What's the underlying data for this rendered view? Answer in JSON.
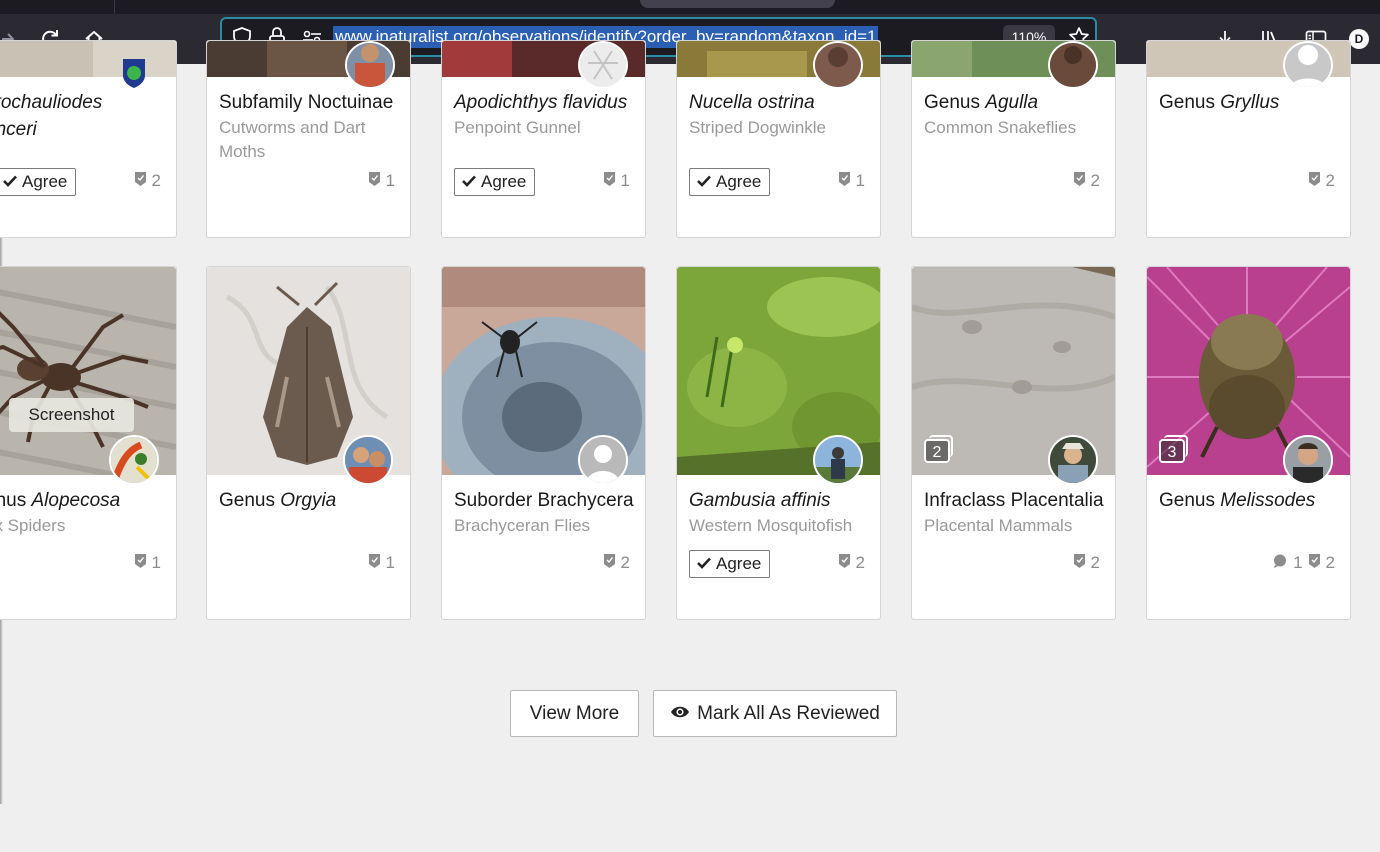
{
  "browser": {
    "url": "www.inaturalist.org/observations/identify?order_by=random&taxon_id=1",
    "zoom": "110%",
    "profile_initial": "D"
  },
  "row1": [
    {
      "title_prefix": "",
      "title_italic": "otochauliodes",
      "title2_italic": "enceri",
      "subtitle": "",
      "agree": "Agree",
      "count": "2"
    },
    {
      "title_prefix": "Subfamily Noctuinae",
      "title_italic": "",
      "subtitle": "Cutworms and Dart Moths",
      "agree": "",
      "count": "1"
    },
    {
      "title_prefix": "",
      "title_italic": "Apodichthys flavidus",
      "subtitle": "Penpoint Gunnel",
      "agree": "Agree",
      "count": "1"
    },
    {
      "title_prefix": "",
      "title_italic": "Nucella ostrina",
      "subtitle": "Striped Dogwinkle",
      "agree": "Agree",
      "count": "1"
    },
    {
      "title_prefix": "Genus ",
      "title_italic": "Agulla",
      "subtitle": "Common Snakeflies",
      "agree": "",
      "count": "2"
    },
    {
      "title_prefix": "Genus ",
      "title_italic": "Gryllus",
      "subtitle": "",
      "agree": "",
      "count": "2"
    }
  ],
  "row2": [
    {
      "title_prefix": "enus ",
      "title_italic": "Alopecosa",
      "subtitle": "ox Spiders",
      "agree": "",
      "count": "1",
      "tooltip": "Screenshot"
    },
    {
      "title_prefix": "Genus ",
      "title_italic": "Orgyia",
      "subtitle": "",
      "agree": "",
      "count": "1"
    },
    {
      "title_prefix": "Suborder Brachycera",
      "title_italic": "",
      "subtitle": "Brachyceran Flies",
      "agree": "",
      "count": "2"
    },
    {
      "title_prefix": "",
      "title_italic": "Gambusia affinis",
      "subtitle": "Western Mosquitofish",
      "agree": "Agree",
      "count": "2"
    },
    {
      "title_prefix": "Infraclass Placentalia",
      "title_italic": "",
      "subtitle": "Placental Mammals",
      "agree": "",
      "count": "2",
      "photos": "2"
    },
    {
      "title_prefix": "Genus ",
      "title_italic": "Melissodes",
      "subtitle": "",
      "agree": "",
      "count": "2",
      "comments": "1",
      "photos": "3"
    }
  ],
  "actions": {
    "view_more": "View More",
    "mark_all": "Mark All As Reviewed"
  },
  "colors": {
    "url_highlight": "#2a5fb4",
    "focus_ring": "#2a8ba3",
    "page_bg": "#efefef"
  }
}
